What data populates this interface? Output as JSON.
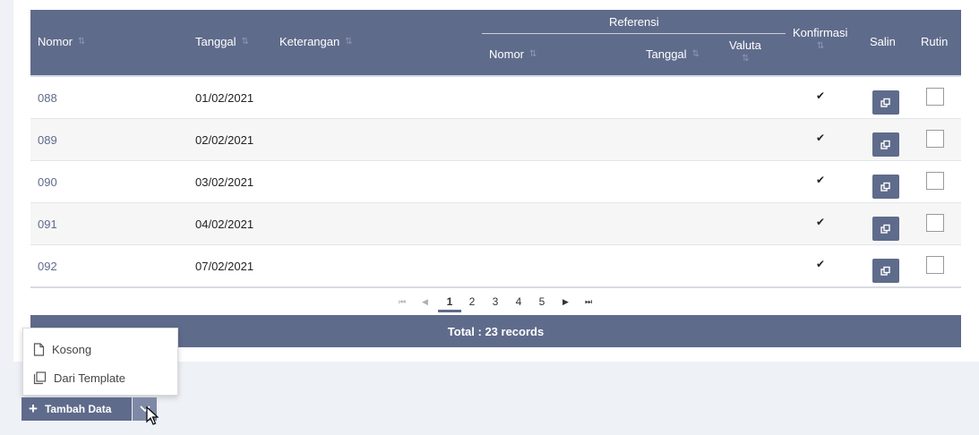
{
  "table": {
    "headers": {
      "nomor": "Nomor",
      "tanggal": "Tanggal",
      "keterangan": "Keterangan",
      "referensi": "Referensi",
      "ref_nomor": "Nomor",
      "ref_tanggal": "Tanggal",
      "valuta": "Valuta",
      "konfirmasi": "Konfirmasi",
      "salin": "Salin",
      "rutin": "Rutin"
    },
    "rows": [
      {
        "nomor": "088",
        "tanggal": "01/02/2021",
        "konfirmasi": "✔",
        "rutin": false
      },
      {
        "nomor": "089",
        "tanggal": "02/02/2021",
        "konfirmasi": "✔",
        "rutin": false
      },
      {
        "nomor": "090",
        "tanggal": "03/02/2021",
        "konfirmasi": "✔",
        "rutin": false
      },
      {
        "nomor": "091",
        "tanggal": "04/02/2021",
        "konfirmasi": "✔",
        "rutin": false
      },
      {
        "nomor": "092",
        "tanggal": "07/02/2021",
        "konfirmasi": "✔",
        "rutin": false
      }
    ]
  },
  "pagination": {
    "pages": [
      "1",
      "2",
      "3",
      "4",
      "5"
    ],
    "current": "1"
  },
  "total_label": "Total : 23 records",
  "menu": {
    "items": [
      {
        "label": "Kosong",
        "icon": "file-icon"
      },
      {
        "label": "Dari Template",
        "icon": "copy-icon"
      }
    ]
  },
  "actions": {
    "tambah_label": "Tambah Data"
  },
  "colors": {
    "header_bg": "#5f6b8b",
    "accent": "#5f6b8b"
  }
}
